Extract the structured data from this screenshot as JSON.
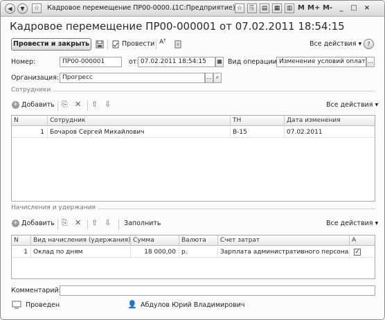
{
  "window": {
    "title": "Кадровое перемещение ПР00-0000...",
    "app_suffix": "(1С:Предприятие)",
    "controls": [
      "M",
      "M+",
      "M-",
      "_",
      "□",
      "×"
    ]
  },
  "doc": {
    "title": "Кадровое перемещение ПР00-000001 от 07.02.2011 18:54:15"
  },
  "toolbar": {
    "post_close": "Провести и закрыть",
    "post": "Провести",
    "all_actions": "Все действия",
    "help": "?"
  },
  "header": {
    "number_label": "Номер:",
    "number_value": "ПР00-000001",
    "date_label": "от:",
    "date_value": "07.02.2011 18:54:15",
    "op_label": "Вид операции:",
    "op_value": "Изменение условий оплаты",
    "org_label": "Организация:",
    "org_value": "Прогресс"
  },
  "employees": {
    "section_title": "Сотрудники",
    "add": "Добавить",
    "all_actions": "Все действия",
    "columns": [
      "N",
      "Сотрудник",
      "ТН",
      "Дата изменения"
    ],
    "rows": [
      {
        "n": "1",
        "name": "Бочаров Сергей Михайлович",
        "tn": "В-15",
        "date": "07.02.2011"
      }
    ]
  },
  "accruals": {
    "section_title": "Начисления и удержания",
    "add": "Добавить",
    "fill": "Заполнить",
    "all_actions": "Все действия",
    "columns": [
      "N",
      "Вид начисления (удержания)",
      "Сумма",
      "Валюта",
      "Счет затрат",
      "А"
    ],
    "rows": [
      {
        "n": "1",
        "kind": "Оклад по дням",
        "sum": "18 000,00",
        "currency": "р.",
        "account": "Зарплата административного персонала",
        "a": "✓"
      }
    ]
  },
  "footer": {
    "comment_label": "Комментарий:",
    "comment_value": "",
    "status": "Проведен",
    "author": "Абдулов Юрий Владимирович"
  }
}
